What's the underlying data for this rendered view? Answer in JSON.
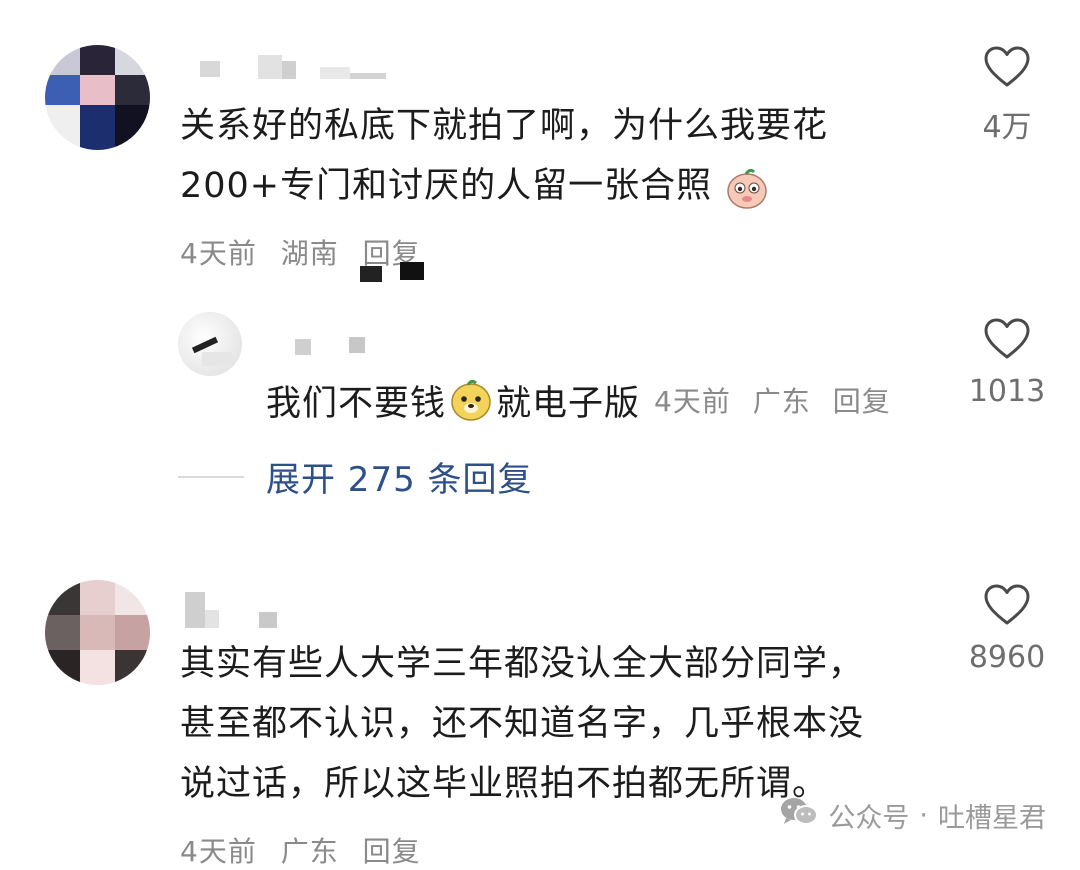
{
  "comments": [
    {
      "text_lines": [
        "关系好的私底下就拍了啊，为什么我要花",
        "200+专门和讨厌的人留一张合照"
      ],
      "time": "4天前",
      "location": "湖南",
      "reply_label": "回复",
      "likes": "4万"
    },
    {
      "text_lines": [
        "其实有些人大学三年都没认全大部分同学，",
        "甚至都不认识，还不知道名字，几乎根本没",
        "说过话，所以这毕业照拍不拍都无所谓。"
      ],
      "time": "4天前",
      "location": "广东",
      "reply_label": "回复",
      "likes": "8960"
    }
  ],
  "reply": {
    "text_before": "我们不要钱",
    "text_after": "就电子版",
    "time": "4天前",
    "location": "广东",
    "reply_label": "回复",
    "likes": "1013"
  },
  "expand_label": "展开 275 条回复",
  "watermark": {
    "label": "公众号",
    "dot": "·",
    "name": "吐槽星君"
  },
  "icons": {
    "like": "heart-outline-icon",
    "emoji_1": "pink-face-emoji",
    "emoji_2": "yellow-dog-emoji",
    "watermark": "wechat-icon"
  }
}
